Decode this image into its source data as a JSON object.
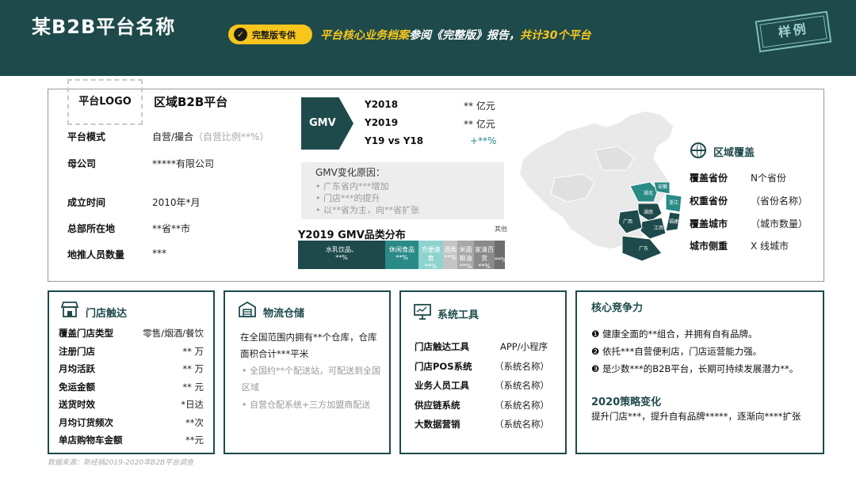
{
  "header": {
    "title": "某B2B平台名称",
    "badge": "完整版专供",
    "subtitle_prefix": "平台核心业务档案",
    "subtitle_mid": "参阅《完整版》报告，",
    "subtitle_suffix": "共计30个平台",
    "stamp": "样例",
    "bg_color": "#1e4a4b",
    "accent_color": "#f7c61c"
  },
  "platform": {
    "logo_label": "平台LOGO",
    "name": "区域B2B平台",
    "fields": [
      {
        "label": "平台模式",
        "value": "自营/撮合",
        "note": "（自营比例**%）"
      },
      {
        "label": "母公司",
        "value": "*****有限公司",
        "note": ""
      },
      {
        "label": "成立时间",
        "value": "2010年*月",
        "note": ""
      },
      {
        "label": "总部所在地",
        "value": "**省**市",
        "note": ""
      },
      {
        "label": "地推人员数量",
        "value": "***",
        "note": ""
      }
    ]
  },
  "gmv": {
    "label": "GMV",
    "rows": [
      {
        "year": "Y2018",
        "value": "** 亿元"
      },
      {
        "year": "Y2019",
        "value": "** 亿元"
      },
      {
        "year": "Y19 vs Y18",
        "value": "+**%"
      }
    ],
    "reason_title": "GMV变化原因：",
    "reasons": [
      "广东省内***增加",
      "门店***的提升",
      "以**省为主，向**省扩张"
    ]
  },
  "category": {
    "title": "Y2019 GMV品类分布",
    "segments": [
      {
        "name": "水乳饮品、",
        "pct": "**%",
        "share": 0.42,
        "color": "#1e4a4b"
      },
      {
        "name": "休闲食品",
        "pct": "**%",
        "share": 0.16,
        "color": "#2a8a86"
      },
      {
        "name": "方便速食",
        "pct": "**%",
        "share": 0.12,
        "color": "#8fd3cf"
      },
      {
        "name": "酒类",
        "pct": "**%",
        "share": 0.07,
        "color": "#c4c4c4"
      },
      {
        "name": "米面粮油",
        "pct": "**%",
        "share": 0.08,
        "color": "#a8a8a8"
      },
      {
        "name": "家清百货",
        "pct": "**%",
        "share": 0.1,
        "color": "#8a8a8a"
      },
      {
        "name": "其他",
        "pct": "**%",
        "share": 0.05,
        "color": "#6e6e6e"
      }
    ]
  },
  "region": {
    "title": "区域覆盖",
    "rows": [
      {
        "label": "覆盖省份",
        "value": "N个省份"
      },
      {
        "label": "权重省份",
        "value": "（省份名称）"
      },
      {
        "label": "覆盖城市",
        "value": "（城市数量）"
      },
      {
        "label": "城市侧重",
        "value": "X 线城市"
      }
    ],
    "map_labels": [
      "湖北",
      "湖南",
      "江西",
      "福建",
      "广东",
      "广西",
      "安徽",
      "浙江"
    ]
  },
  "cards": {
    "store": {
      "title": "门店触达",
      "rows": [
        {
          "label": "覆盖门店类型",
          "value": "零售/烟酒/餐饮"
        },
        {
          "label": "注册门店",
          "value": "** 万"
        },
        {
          "label": "月均活跃",
          "value": "** 万"
        },
        {
          "label": "免运金额",
          "value": "** 元"
        },
        {
          "label": "送货时效",
          "value": "*日达"
        },
        {
          "label": "月均订货频次",
          "value": "**次"
        },
        {
          "label": "单店购物车金额",
          "value": "**元"
        }
      ]
    },
    "logistics": {
      "title": "物流仓储",
      "main": "在全国范围内拥有**个仓库，仓库面积合计***平米",
      "bullets": [
        "全国约**个配送站，可配送到全国区域",
        "自营仓配系统+三方加盟商配送"
      ]
    },
    "system": {
      "title": "系统工具",
      "rows": [
        {
          "label": "门店触达工具",
          "value": "APP/小程序"
        },
        {
          "label": "门店POS系统",
          "value": "（系统名称）"
        },
        {
          "label": "业务人员工具",
          "value": "（系统名称）"
        },
        {
          "label": "供应链系统",
          "value": "（系统名称）"
        },
        {
          "label": "大数据营销",
          "value": "（系统名称）"
        }
      ]
    },
    "competitive": {
      "title": "核心竞争力",
      "items": [
        "❶ 健康全面的**组合，并拥有自有品牌。",
        "❷ 依托***自营便利店，门店运营能力强。",
        "❸ 是少数***的B2B平台，长期可持续发展潜力**。"
      ],
      "strategy_title": "2020策略变化",
      "strategy_text": "提升门店***，提升自有品牌*****，逐渐向****扩张"
    }
  },
  "source": "数据来源：新经销2019-2020年B2B平台调查"
}
